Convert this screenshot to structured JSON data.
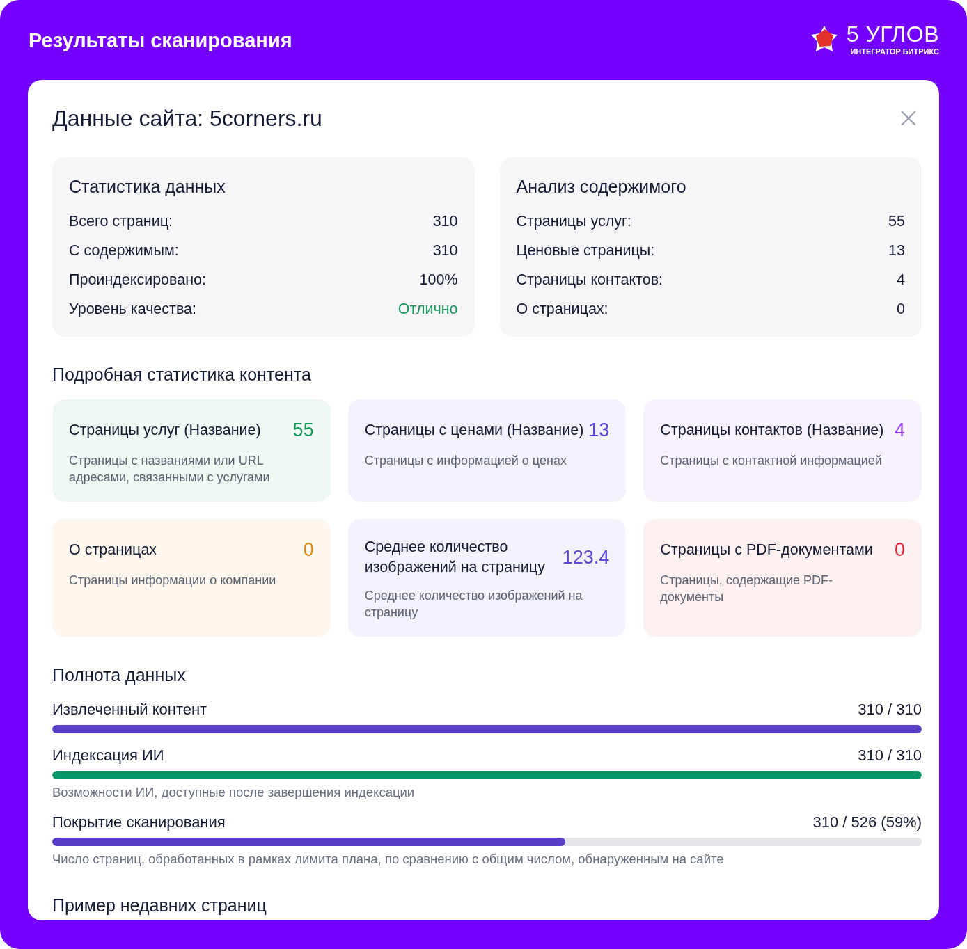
{
  "header": {
    "title": "Результаты сканирования",
    "logo": {
      "name": "5 УГЛОВ",
      "tagline": "ИНТЕГРАТОР БИТРИКС"
    }
  },
  "dialog": {
    "title": "Данные сайта: 5corners.ru",
    "stat_panels": [
      {
        "title": "Статистика данных",
        "rows": [
          {
            "label": "Всего страниц:",
            "value": "310",
            "color": "#151a33"
          },
          {
            "label": "С содержимым:",
            "value": "310",
            "color": "#151a33"
          },
          {
            "label": "Проиндексировано:",
            "value": "100%",
            "color": "#151a33"
          },
          {
            "label": "Уровень качества:",
            "value": "Отлично",
            "color": "#16985a"
          }
        ]
      },
      {
        "title": "Анализ содержимого",
        "rows": [
          {
            "label": "Страницы услуг:",
            "value": "55",
            "color": "#151a33"
          },
          {
            "label": "Ценовые страницы:",
            "value": "13",
            "color": "#151a33"
          },
          {
            "label": "Страницы контактов:",
            "value": "4",
            "color": "#151a33"
          },
          {
            "label": "О страницах:",
            "value": "0",
            "color": "#151a33"
          }
        ]
      }
    ],
    "details": {
      "title": "Подробная статистика контента",
      "cards": [
        {
          "title": "Страницы услуг (Название)",
          "value": "55",
          "description": "Страницы с названиями или URL адресами, связанными с услугами",
          "color": "#16985a"
        },
        {
          "title": "Страницы с ценами (Название)",
          "value": "13",
          "description": "Страницы с информацией о ценах",
          "color": "#5b45d6"
        },
        {
          "title": "Страницы контактов (Название)",
          "value": "4",
          "description": "Страницы с контактной информацией",
          "color": "#9a3ef0"
        },
        {
          "title": "О страницах",
          "value": "0",
          "description": "Страницы информации о компании",
          "color": "#dd8a0c"
        },
        {
          "title": "Среднее количество изображений на страницу",
          "value": "123.4",
          "description": "Среднее количество изображений на страницу",
          "color": "#5b45d6"
        },
        {
          "title": "Страницы с PDF-документами",
          "value": "0",
          "description": "Страницы, содержащие PDF-документы",
          "color": "#e0243c"
        }
      ]
    },
    "completeness": {
      "title": "Полнота данных",
      "items": [
        {
          "label": "Извлеченный контент",
          "reading": "310 / 310",
          "level": 1,
          "color": "#5a3ec8"
        },
        {
          "label": "Индексация ИИ",
          "reading": "310 / 310",
          "level": 1,
          "color": "#079669",
          "note": "Возможности ИИ, доступные после завершения индексации"
        },
        {
          "label": "Покрытие сканирования",
          "reading": "310 / 526 (59%)",
          "level": 0.59,
          "color": "#5a3ec8",
          "note": "Число страниц, обработанных в рамках лимита плана, по сравнению с общим числом, обнаруженным на сайте"
        }
      ]
    },
    "recent": {
      "title": "Пример недавних страниц"
    }
  }
}
